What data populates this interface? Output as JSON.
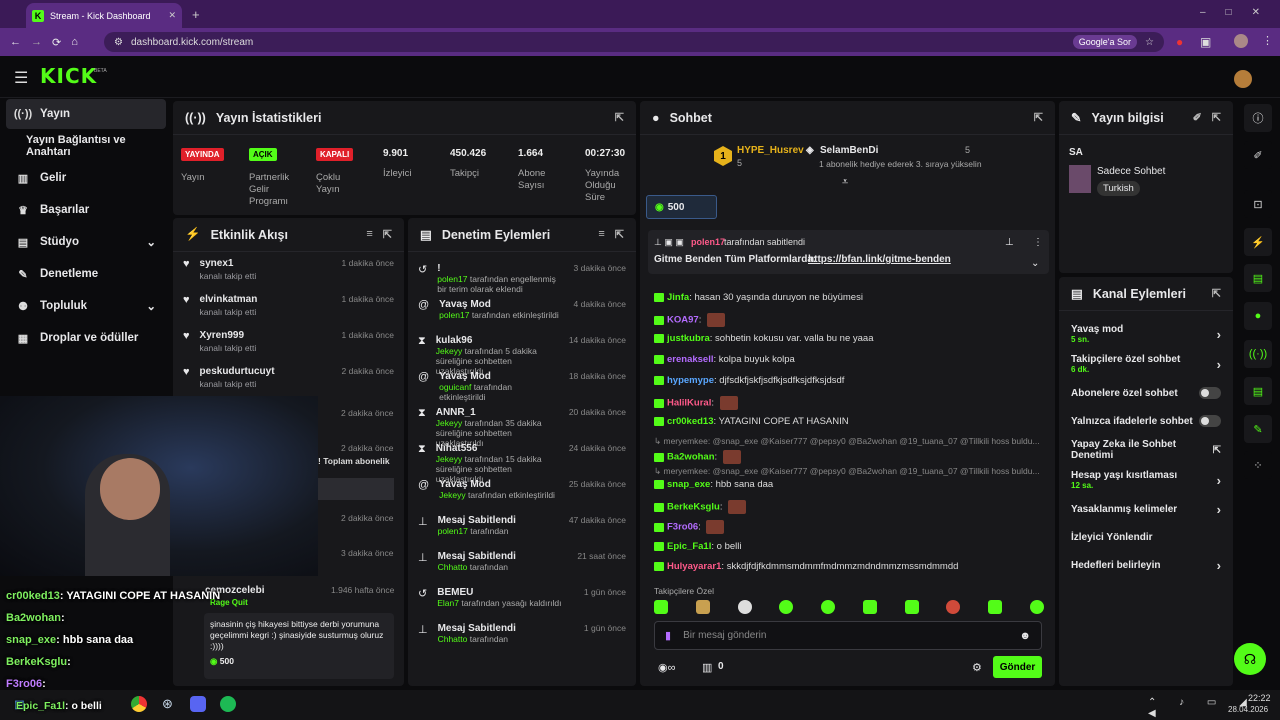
{
  "browser": {
    "tab_title": "Stream - Kick Dashboard",
    "url": "dashboard.kick.com/stream",
    "google_label": "Google'a Sor"
  },
  "header": {
    "logo": "KICK",
    "beta": "BETA"
  },
  "sidebar": {
    "items": [
      {
        "label": "Yayın"
      },
      {
        "label": "Yayın Bağlantısı ve Anahtarı"
      },
      {
        "label": "Gelir"
      },
      {
        "label": "Başarılar"
      },
      {
        "label": "Stüdyo"
      },
      {
        "label": "Denetleme"
      },
      {
        "label": "Topluluk"
      },
      {
        "label": "Droplar ve ödüller"
      }
    ]
  },
  "stats": {
    "title": "Yayın İstatistikleri",
    "badges": [
      "YAYINDA",
      "AÇIK",
      "KAPALI"
    ],
    "labels": [
      "Yayın",
      "Partnerlik Gelir Programı",
      "Çoklu Yayın",
      "İzleyici",
      "Takipçi",
      "Abone Sayısı",
      "Yayında Olduğu Süre"
    ],
    "values": [
      "9.901",
      "450.426",
      "1.664",
      "00:27:30"
    ]
  },
  "activity": {
    "title": "Etkinlik Akışı",
    "items": [
      {
        "name": "synex1",
        "desc": "kanalı takip etti",
        "time": "1 dakika önce"
      },
      {
        "name": "elvinkatman",
        "desc": "kanalı takip etti",
        "time": "1 dakika önce"
      },
      {
        "name": "Xyren999",
        "desc": "kanalı takip etti",
        "time": "1 dakika önce"
      },
      {
        "name": "peskudurtucuyt",
        "desc": "kanalı takip etti",
        "time": "2 dakika önce"
      },
      {
        "time": "2 dakika önce"
      },
      {
        "time": "2 dakika önce",
        "desc": "! Toplam abonelik"
      },
      {
        "time": "2 dakika önce"
      },
      {
        "time": "3 dakika önce"
      }
    ],
    "last": {
      "name": "cemozcelebi",
      "tag": "Rage Quit",
      "time": "1.946 hafta önce",
      "message": "şinasinin çiş hikayesi bittiyse derbi yorumuna geçelimmi kegri :) şinasiyide susturmuş oluruz :))))",
      "amount": "500"
    }
  },
  "moderation": {
    "title": "Denetim Eylemleri",
    "items": [
      {
        "name": "!",
        "user": "polen17",
        "desc": "tarafından engellenmiş bir terim olarak eklendi",
        "time": "3 dakika önce"
      },
      {
        "name": "Yavaş Mod",
        "user": "polen17",
        "desc": "tarafından etkinleştirildi",
        "time": "4 dakika önce"
      },
      {
        "name": "kulak96",
        "user": "Jekeyy",
        "desc": "tarafından 5 dakika süreliğine sohbetten uzaklaştırıldı",
        "time": "14 dakika önce"
      },
      {
        "name": "Yavaş Mod",
        "user": "oguicanf",
        "desc": "tarafından etkinleştirildi",
        "time": "18 dakika önce"
      },
      {
        "name": "ANNR_1",
        "user": "Jekeyy",
        "desc": "tarafından 35 dakika süreliğine sohbetten uzaklaştırıldı",
        "time": "20 dakika önce"
      },
      {
        "name": "Nihat556",
        "user": "Jekeyy",
        "desc": "tarafından 15 dakika süreliğine sohbetten uzaklaştırıldı",
        "time": "24 dakika önce"
      },
      {
        "name": "Yavaş Mod",
        "user": "Jekeyy",
        "desc": "tarafından etkinleştirildi",
        "time": "25 dakika önce"
      },
      {
        "name": "Mesaj Sabitlendi",
        "user": "polen17",
        "desc": "tarafından",
        "time": "47 dakika önce"
      },
      {
        "name": "Mesaj Sabitlendi",
        "user": "Chhatto",
        "desc": "tarafından",
        "time": "21 saat önce"
      },
      {
        "name": "BEMEU",
        "user": "Elan7",
        "desc": "tarafından yasağı kaldırıldı",
        "time": "1 gün önce"
      },
      {
        "name": "Mesaj Sabitlendi",
        "user": "Chhatto",
        "desc": "tarafından",
        "time": "1 gün önce"
      }
    ]
  },
  "chat": {
    "title": "Sohbet",
    "hype_user": "HYPE_Husrev",
    "hype_count": "5",
    "gifter": "SelamBenDi",
    "gift_count": "5",
    "gift_text": "1 abonelik hediye ederek 3. sıraya yükselin",
    "kick_amount": "500",
    "pin_by": "polen17",
    "pin_suffix": "tarafından sabitlendi",
    "pin_text": "Gitme Benden Tüm Platformlarda:",
    "pin_link": "https://bfan.link/gitme-benden",
    "messages": [
      {
        "user": "Jinfa",
        "color": "#53fc18",
        "text": "hasan 30 yaşında duruyon ne büyümesi"
      },
      {
        "user": "KOA97",
        "color": "#b46cff",
        "text": ""
      },
      {
        "user": "justkubra",
        "color": "#53fc18",
        "text": "sohbetin kokusu var. valla bu ne yaaa"
      },
      {
        "user": "erenaksell",
        "color": "#b46cff",
        "text": "kolpa buyuk kolpa"
      },
      {
        "user": "hypemype",
        "color": "#5aa7ff",
        "text": "djfsdkfjskfjsdfkjsdfksjdfksjdsdf"
      },
      {
        "user": "HalilKural",
        "color": "#ff5a8a",
        "text": ""
      },
      {
        "user": "cr00ked13",
        "color": "#53fc18",
        "text": "YATAGINI COPE AT HASANIN"
      },
      {
        "reply": "meryemkee: @snap_exe @Kaiser777 @pepsy0 @Ba2wohan @19_tuana_07 @Tillkili hoss buldu..."
      },
      {
        "user": "Ba2wohan",
        "color": "#53fc18",
        "text": ""
      },
      {
        "reply": "meryemkee: @snap_exe @Kaiser777 @pepsy0 @Ba2wohan @19_tuana_07 @Tillkili hoss buldu..."
      },
      {
        "user": "snap_exe",
        "color": "#53fc18",
        "text": "hbb sana daa"
      },
      {
        "user": "BerkeKsglu",
        "color": "#53fc18",
        "text": ""
      },
      {
        "user": "F3ro06",
        "color": "#b46cff",
        "text": ""
      },
      {
        "user": "Epic_Fa1l",
        "color": "#53fc18",
        "text": "o belli"
      },
      {
        "user": "Hulyayarar1",
        "color": "#ff5a8a",
        "text": "skkdjfdjfkdmmsmdmmfmdmmzmdndmmzmssmdmmdd"
      }
    ],
    "followers_only": "Takipçilere Özel",
    "input_placeholder": "Bir mesaj gönderin",
    "points": "0",
    "send": "Gönder"
  },
  "info": {
    "title": "Yayın bilgisi",
    "label": "SA",
    "category": "Sadece Sohbet",
    "language": "Turkish"
  },
  "channel": {
    "title": "Kanal Eylemleri",
    "items": [
      {
        "label": "Yavaş mod",
        "sub": "5 sn."
      },
      {
        "label": "Takipçilere özel sohbet",
        "sub": "6 dk."
      },
      {
        "label": "Abonelere özel sohbet"
      },
      {
        "label": "Yalnızca ifadelerle sohbet"
      },
      {
        "label": "Yapay Zeka ile Sohbet Denetimi"
      },
      {
        "label": "Hesap yaşı kısıtlaması",
        "sub": "12 sa."
      },
      {
        "label": "Yasaklanmış kelimeler"
      },
      {
        "label": "İzleyici Yönlendir"
      },
      {
        "label": "Hedefleri belirleyin"
      }
    ]
  },
  "overlay": {
    "lines": [
      {
        "user": "cr00ked13",
        "text": ": YATAGINI COPE AT HASANIN"
      },
      {
        "user": "Ba2wohan",
        "text": ":"
      },
      {
        "user": "snap_exe",
        "text": ": hbb sana daa"
      },
      {
        "user": "BerkeKsglu",
        "text": ":"
      },
      {
        "user": "F3ro06",
        "text": ":"
      },
      {
        "user": "Epic_Fa1l",
        "text": ": o belli"
      }
    ]
  },
  "taskbar": {
    "time": "22:22",
    "date": "28.04.2026"
  },
  "colors": {
    "accent": "#53fc18",
    "browser": "#5a2c82",
    "panel": "#18181b"
  }
}
